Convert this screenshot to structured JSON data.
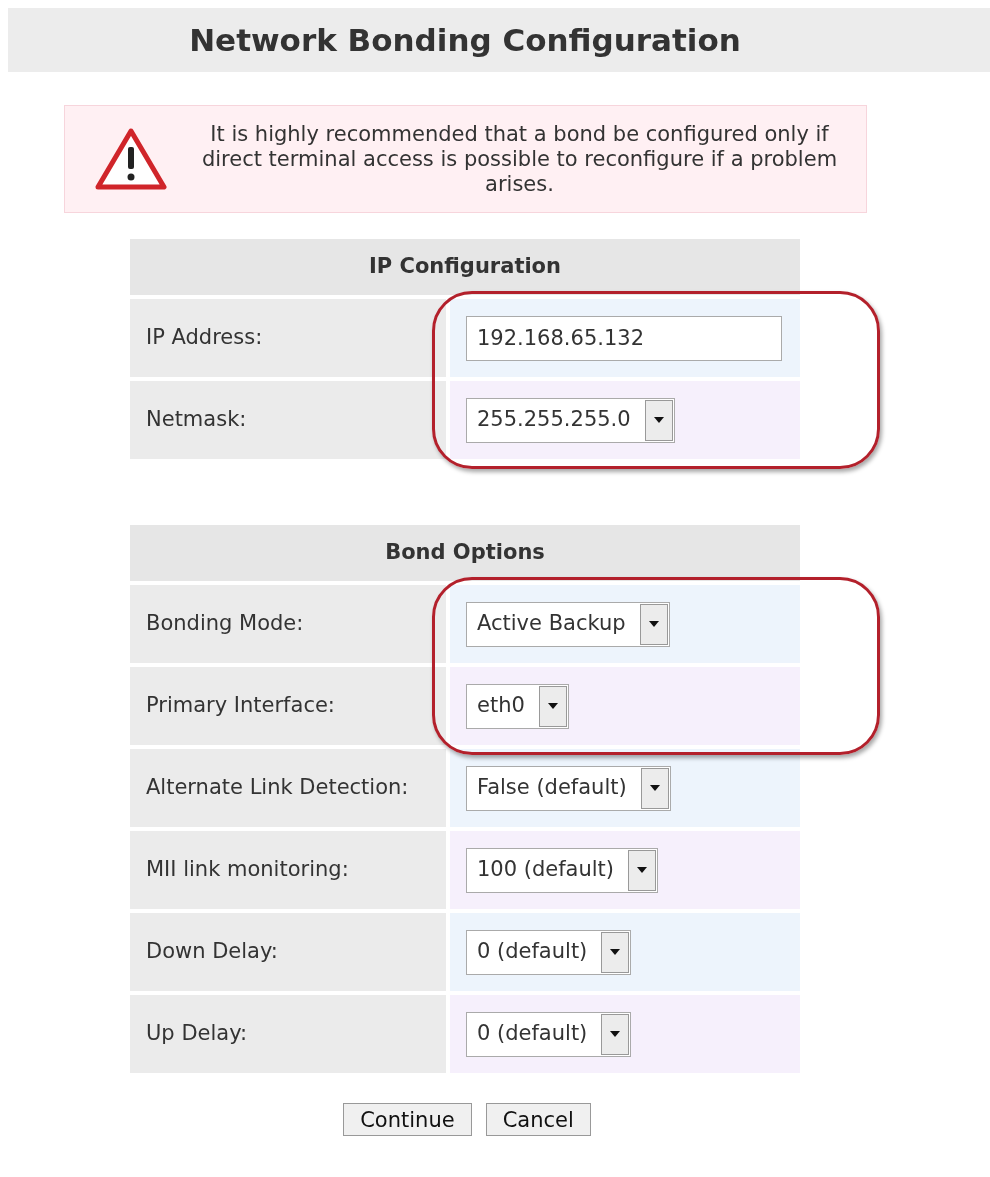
{
  "title": "Network Bonding Configuration",
  "warning": {
    "text": "It is highly recommended that a bond be configured only if direct terminal access is possible to reconfigure if a problem arises."
  },
  "sections": [
    {
      "heading": "IP Configuration",
      "fields": [
        {
          "label": "IP Address:",
          "kind": "text",
          "value": "192.168.65.132",
          "highlighted": true
        },
        {
          "label": "Netmask:",
          "kind": "select",
          "value": "255.255.255.0",
          "highlighted": true
        }
      ]
    },
    {
      "heading": "Bond Options",
      "fields": [
        {
          "label": "Bonding Mode:",
          "kind": "select",
          "value": "Active Backup",
          "highlighted": true
        },
        {
          "label": "Primary Interface:",
          "kind": "select",
          "value": "eth0",
          "highlighted": true
        },
        {
          "label": "Alternate Link Detection:",
          "kind": "select",
          "value": "False (default)",
          "highlighted": false
        },
        {
          "label": "MII link monitoring:",
          "kind": "select",
          "value": "100 (default)",
          "highlighted": false
        },
        {
          "label": "Down Delay:",
          "kind": "select",
          "value": "0 (default)",
          "highlighted": false
        },
        {
          "label": "Up Delay:",
          "kind": "select",
          "value": "0 (default)",
          "highlighted": false
        }
      ]
    }
  ],
  "buttons": [
    "Continue",
    "Cancel"
  ]
}
